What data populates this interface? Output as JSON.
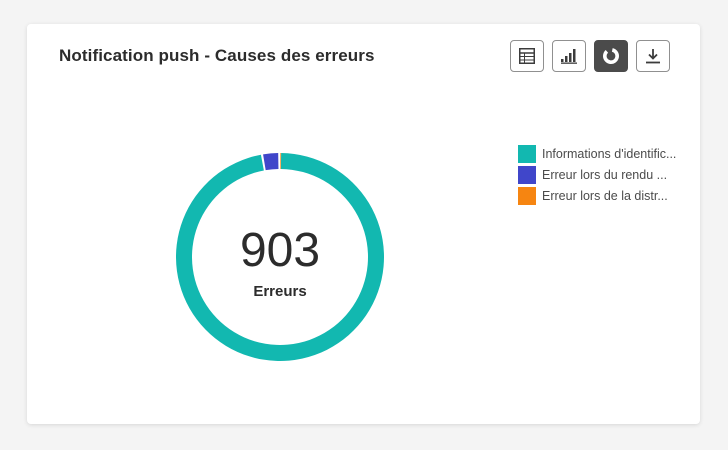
{
  "card": {
    "title": "Notification push - Causes des erreurs"
  },
  "toolbar": {
    "buttons": [
      {
        "icon": "table-icon",
        "selected": false
      },
      {
        "icon": "bar-chart-icon",
        "selected": false
      },
      {
        "icon": "donut-chart-icon",
        "selected": true
      },
      {
        "icon": "download-icon",
        "selected": false
      }
    ]
  },
  "summary": {
    "value": "903",
    "label": "Erreurs"
  },
  "colors": {
    "teal": "#12b8b0",
    "blue": "#4046ca",
    "orange": "#f68511"
  },
  "chart_data": {
    "type": "pie",
    "total": 903,
    "series": [
      {
        "label": "Informations d'identific...",
        "value": 878,
        "color": "#12b8b0"
      },
      {
        "label": "Erreur lors du rendu ...",
        "value": 24,
        "color": "#4046ca"
      },
      {
        "label": "Erreur lors de la distr...",
        "value": 1,
        "color": "#f68511"
      }
    ],
    "legend_position": "right"
  }
}
